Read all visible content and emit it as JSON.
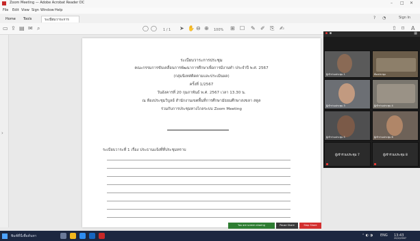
{
  "window": {
    "title": "Zoom Meeting — Adobe Acrobat Reader DC",
    "menu": [
      "File",
      "Edit",
      "View",
      "Sign",
      "Window",
      "Help"
    ]
  },
  "tabs": {
    "home": "Home",
    "tools": "Tools",
    "document": "ระเบียบวาระการประชุม...",
    "sign_in": "Sign In"
  },
  "toolbar": {
    "page_info": "1 / 1",
    "zoom": "100%"
  },
  "document": {
    "lines": [
      "ระเบียบวาระการประชุม",
      "คณะกรรมการขับเคลื่อนการพัฒนาการศึกษาเพื่อการมีงานทำ ประจำปี พ.ศ. 2567",
      "(กลุ่มนิเทศติดตามและประเมินผล)",
      "ครั้งที่ 1/2567",
      "วันอังคารที่ 20 กุมภาพันธ์ พ.ศ. 2567 เวลา 13.30 น.",
      "ณ ห้องประชุมวิบูลย์ สำนักงานเขตพื้นที่การศึกษามัธยมศึกษาสงขลา สตูล",
      "ร่วมกับการประชุมทางไกลระบบ Zoom Meeting"
    ],
    "agenda_item": "ระเบียบวาระที่ 1 เรื่อง ประธานแจ้งที่ที่ประชุมทราบ"
  },
  "zoom": {
    "participants": [
      {
        "name": "ผู้เข้าร่วมประชุม 1"
      },
      {
        "name": "ห้องประชุม"
      },
      {
        "name": "ผู้เข้าร่วมประชุม 3"
      },
      {
        "name": "ผู้เข้าร่วมประชุม 4"
      },
      {
        "name": "ผู้เข้าร่วมประชุม 5"
      },
      {
        "name": "ผู้เข้าร่วมประชุม 6"
      },
      {
        "name": "ผู้เข้าร่วมประชุม 7",
        "label": "ผู้เข้าร่วมประชุม 7"
      },
      {
        "name": "ผู้เข้าร่วมประชุม 8",
        "label": "ผู้เข้าร่วมประชุม 8"
      }
    ],
    "controls": {
      "share": "You are screen sharing",
      "pause": "Pause Share",
      "stop": "Stop Share"
    }
  },
  "taskbar": {
    "search": "พิมพ์ที่นี่เพื่อค้นหา",
    "time": "13:43",
    "date": "20/2/2567",
    "lang": "ENG"
  },
  "colors": {
    "zoom_green": "#2e7d32",
    "zoom_red": "#d32f2f",
    "taskbar": "#1c2740"
  }
}
